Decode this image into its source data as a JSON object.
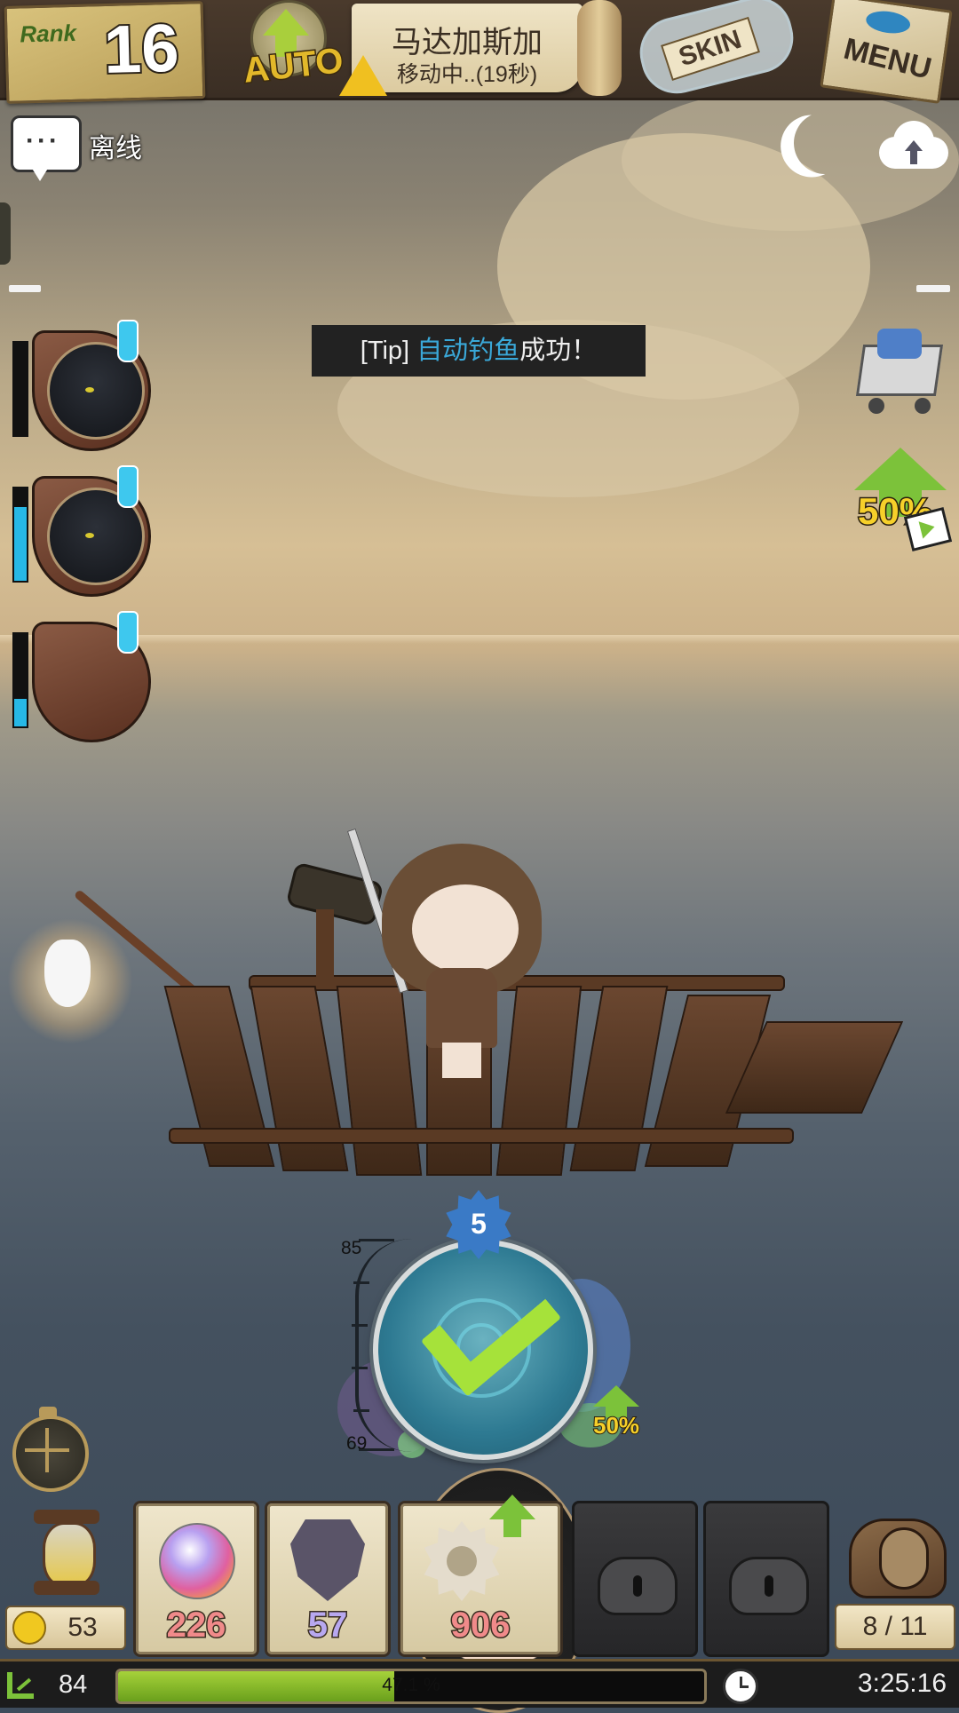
{
  "top_bar": {
    "rank_label": "Rank",
    "rank_value": "16",
    "auto_label": "AUTO",
    "location_name": "马达加斯加",
    "location_status": "移动中..(19秒)",
    "skin_label": "SKIN",
    "menu_label": "MENU"
  },
  "chat": {
    "status_label": "离线"
  },
  "tip": {
    "prefix": "[Tip] ",
    "highlight": "自动钓鱼",
    "suffix": "成功！"
  },
  "crew": [
    {
      "name": "black-cat",
      "hp_fraction": 0.0
    },
    {
      "name": "black-cat",
      "hp_fraction": 0.8
    },
    {
      "name": "girl",
      "hp_fraction": 0.3
    }
  ],
  "boost": {
    "label": "50%"
  },
  "gauge": {
    "top_value": "85",
    "bottom_value": "69",
    "level": "5",
    "boost_label": "50%"
  },
  "inventory": {
    "gold": "53",
    "slots": [
      {
        "item": "orb",
        "count": "226",
        "color": "#f08a8a"
      },
      {
        "item": "shield",
        "count": "57",
        "color": "#b8a8f0"
      },
      {
        "item": "shell",
        "count": "906",
        "color": "#f08a8a",
        "upgrade": true
      },
      {
        "item": "locked"
      },
      {
        "item": "locked"
      }
    ],
    "bag_capacity": "8 / 11"
  },
  "status": {
    "level": "84",
    "exp_percent": 47.1,
    "exp_label": "47.1 %",
    "time": "3:25:16"
  },
  "colors": {
    "accent": "#27b8e6",
    "exp": "#a6d23a",
    "boost": "#7cc23a"
  }
}
